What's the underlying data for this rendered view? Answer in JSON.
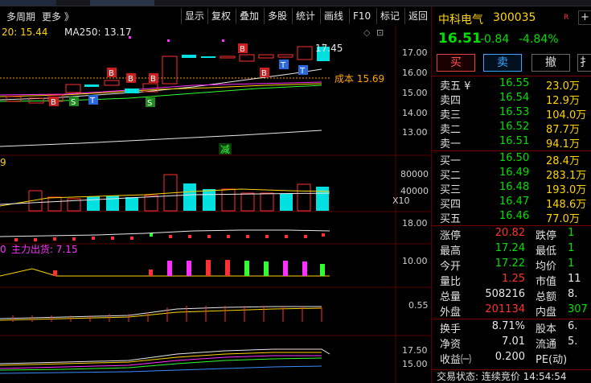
{
  "toolbar": {
    "left_labels": [
      "多周期",
      "更多 》"
    ],
    "buttons": [
      "显示",
      "复权",
      "叠加",
      "多股",
      "统计",
      "画线",
      "F10",
      "标记",
      "返回"
    ]
  },
  "chart": {
    "main_indicator": {
      "ma20": "20: 15.44",
      "ma250": "MA250: 13.17"
    },
    "cost_line_label": "成本 15.69",
    "high_label": "17.45",
    "price_axis": [
      "17.00",
      "16.00",
      "15.00",
      "14.00",
      "13.00"
    ],
    "volume_axis": [
      "80000",
      "40000"
    ],
    "volume_unit": "X10",
    "volume_left_value": "9",
    "panel3_axis": "18.00",
    "fund_flow_label": "主力出货: 7.15",
    "fund_flow_left_value": "0",
    "panel4_axis": "10.00",
    "panel5_axis": "0.55",
    "panel6_axis": [
      "17.50",
      "15.00"
    ],
    "reduce_marker": "减",
    "b_marker": "B",
    "s_marker": "S",
    "t_marker": "T",
    "colors": {
      "up": "#ff3030",
      "down": "#00e0e0",
      "ma_yellow": "#ffd400",
      "ma_white": "#e8e8e8",
      "ma_magenta": "#ff30ff"
    }
  },
  "panel": {
    "name": "中科电气",
    "code": "300035",
    "rtag": "R",
    "plus": "+",
    "price": "16.51",
    "change": "-0.84",
    "change_pct": "-4.84%",
    "buttons": {
      "buy": "买",
      "sell": "卖",
      "cancel": "撤",
      "extra": "扌"
    },
    "sell_levels": [
      {
        "label": "卖五 ¥",
        "price": "16.55",
        "vol": "23.0万"
      },
      {
        "label": "卖四",
        "price": "16.54",
        "vol": "12.9万"
      },
      {
        "label": "卖三",
        "price": "16.53",
        "vol": "104.0万"
      },
      {
        "label": "卖二",
        "price": "16.52",
        "vol": "87.7万"
      },
      {
        "label": "卖一",
        "price": "16.51",
        "vol": "94.1万"
      }
    ],
    "buy_levels": [
      {
        "label": "买一",
        "price": "16.50",
        "vol": "28.4万"
      },
      {
        "label": "买二",
        "price": "16.49",
        "vol": "283.1万"
      },
      {
        "label": "买三",
        "price": "16.48",
        "vol": "193.0万"
      },
      {
        "label": "买四",
        "price": "16.47",
        "vol": "148.6万"
      },
      {
        "label": "买五",
        "price": "16.46",
        "vol": "77.0万"
      }
    ],
    "stats": [
      {
        "a": "涨停",
        "b": "20.82",
        "bc": "red",
        "c": "跌停",
        "d": "1",
        "dc": "green"
      },
      {
        "a": "最高",
        "b": "17.24",
        "bc": "green",
        "c": "最低",
        "d": "1",
        "dc": "green"
      },
      {
        "a": "今开",
        "b": "17.22",
        "bc": "green",
        "c": "均价",
        "d": "1",
        "dc": "green"
      },
      {
        "a": "量比",
        "b": "1.25",
        "bc": "red",
        "c": "市值",
        "d": "11",
        "dc": "white"
      },
      {
        "a": "总量",
        "b": "508216",
        "bc": "white",
        "c": "总额",
        "d": "8.",
        "dc": "white"
      },
      {
        "a": "外盘",
        "b": "201134",
        "bc": "red",
        "c": "内盘",
        "d": "307",
        "dc": "green"
      }
    ],
    "stats2": [
      {
        "a": "换手",
        "b": "8.71%",
        "bc": "white",
        "c": "股本",
        "d": "6.",
        "dc": "white"
      },
      {
        "a": "净资",
        "b": "7.01",
        "bc": "white",
        "c": "流通",
        "d": "5.",
        "dc": "white"
      },
      {
        "a": "收益㈠",
        "b": "0.200",
        "bc": "white",
        "c": "PE(动)",
        "d": "",
        "dc": "white"
      }
    ],
    "status": "交易状态: 连续竞价 14:54:54"
  }
}
